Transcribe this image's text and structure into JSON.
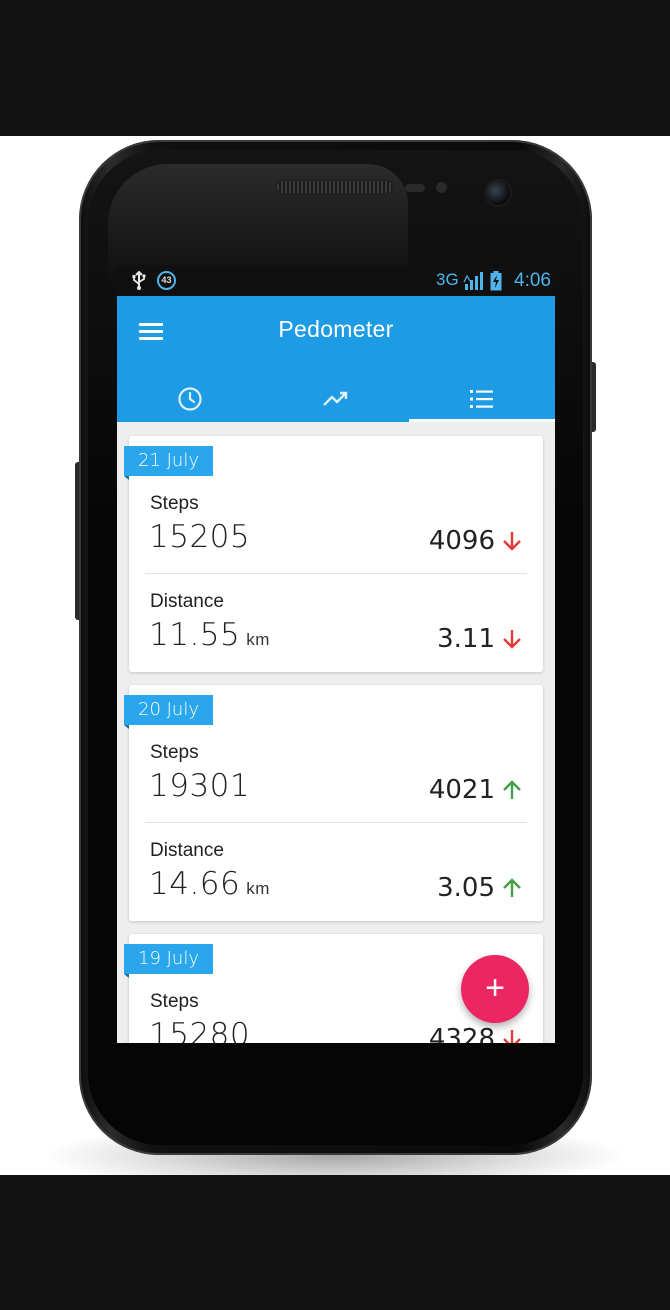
{
  "status_bar": {
    "notification_badge": "43",
    "network": "3G",
    "time": "4:06",
    "usb_icon": "usb-icon",
    "signal_icon": "signal-icon",
    "battery_icon": "battery-charging-icon"
  },
  "app_bar": {
    "title": "Pedometer",
    "menu_icon": "menu-icon",
    "tabs": [
      {
        "icon": "clock-icon",
        "selected": false
      },
      {
        "icon": "trending-up-icon",
        "selected": false
      },
      {
        "icon": "list-icon",
        "selected": true
      }
    ]
  },
  "colors": {
    "primary": "#1d9be4",
    "date_tag": "#2aa7ec",
    "fab": "#ec2662",
    "down": "#e53935",
    "up": "#43a047"
  },
  "days": [
    {
      "date": "21 July",
      "steps_label": "Steps",
      "steps": "15205",
      "steps_delta": "4096",
      "steps_trend": "down",
      "distance_label": "Distance",
      "distance": "11.55",
      "distance_unit": "km",
      "distance_delta": "3.11",
      "distance_trend": "down"
    },
    {
      "date": "20 July",
      "steps_label": "Steps",
      "steps": "19301",
      "steps_delta": "4021",
      "steps_trend": "up",
      "distance_label": "Distance",
      "distance": "14.66",
      "distance_unit": "km",
      "distance_delta": "3.05",
      "distance_trend": "up"
    },
    {
      "date": "19 July",
      "steps_label": "Steps",
      "steps": "15280",
      "steps_delta": "4328",
      "steps_trend": "down"
    }
  ],
  "fab": {
    "label": "+",
    "icon": "add-icon"
  }
}
